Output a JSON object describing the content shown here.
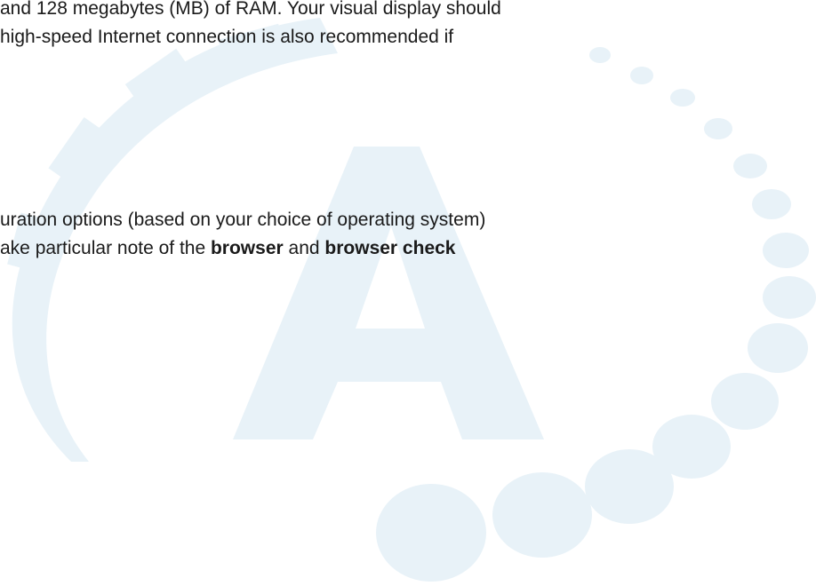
{
  "watermark": {
    "logo_letter": "A",
    "color": "#e8f2f8"
  },
  "section_1": {
    "line_1": " and 128 megabytes (MB) of RAM.  Your visual display should",
    "line_2": "high-speed Internet connection is also recommended if"
  },
  "section_2": {
    "line_1": "uration options (based on your choice of operating system)",
    "line_2_prefix": "ake particular note of the ",
    "line_2_bold_1": "browser",
    "line_2_middle": " and ",
    "line_2_bold_2": "browser check"
  }
}
